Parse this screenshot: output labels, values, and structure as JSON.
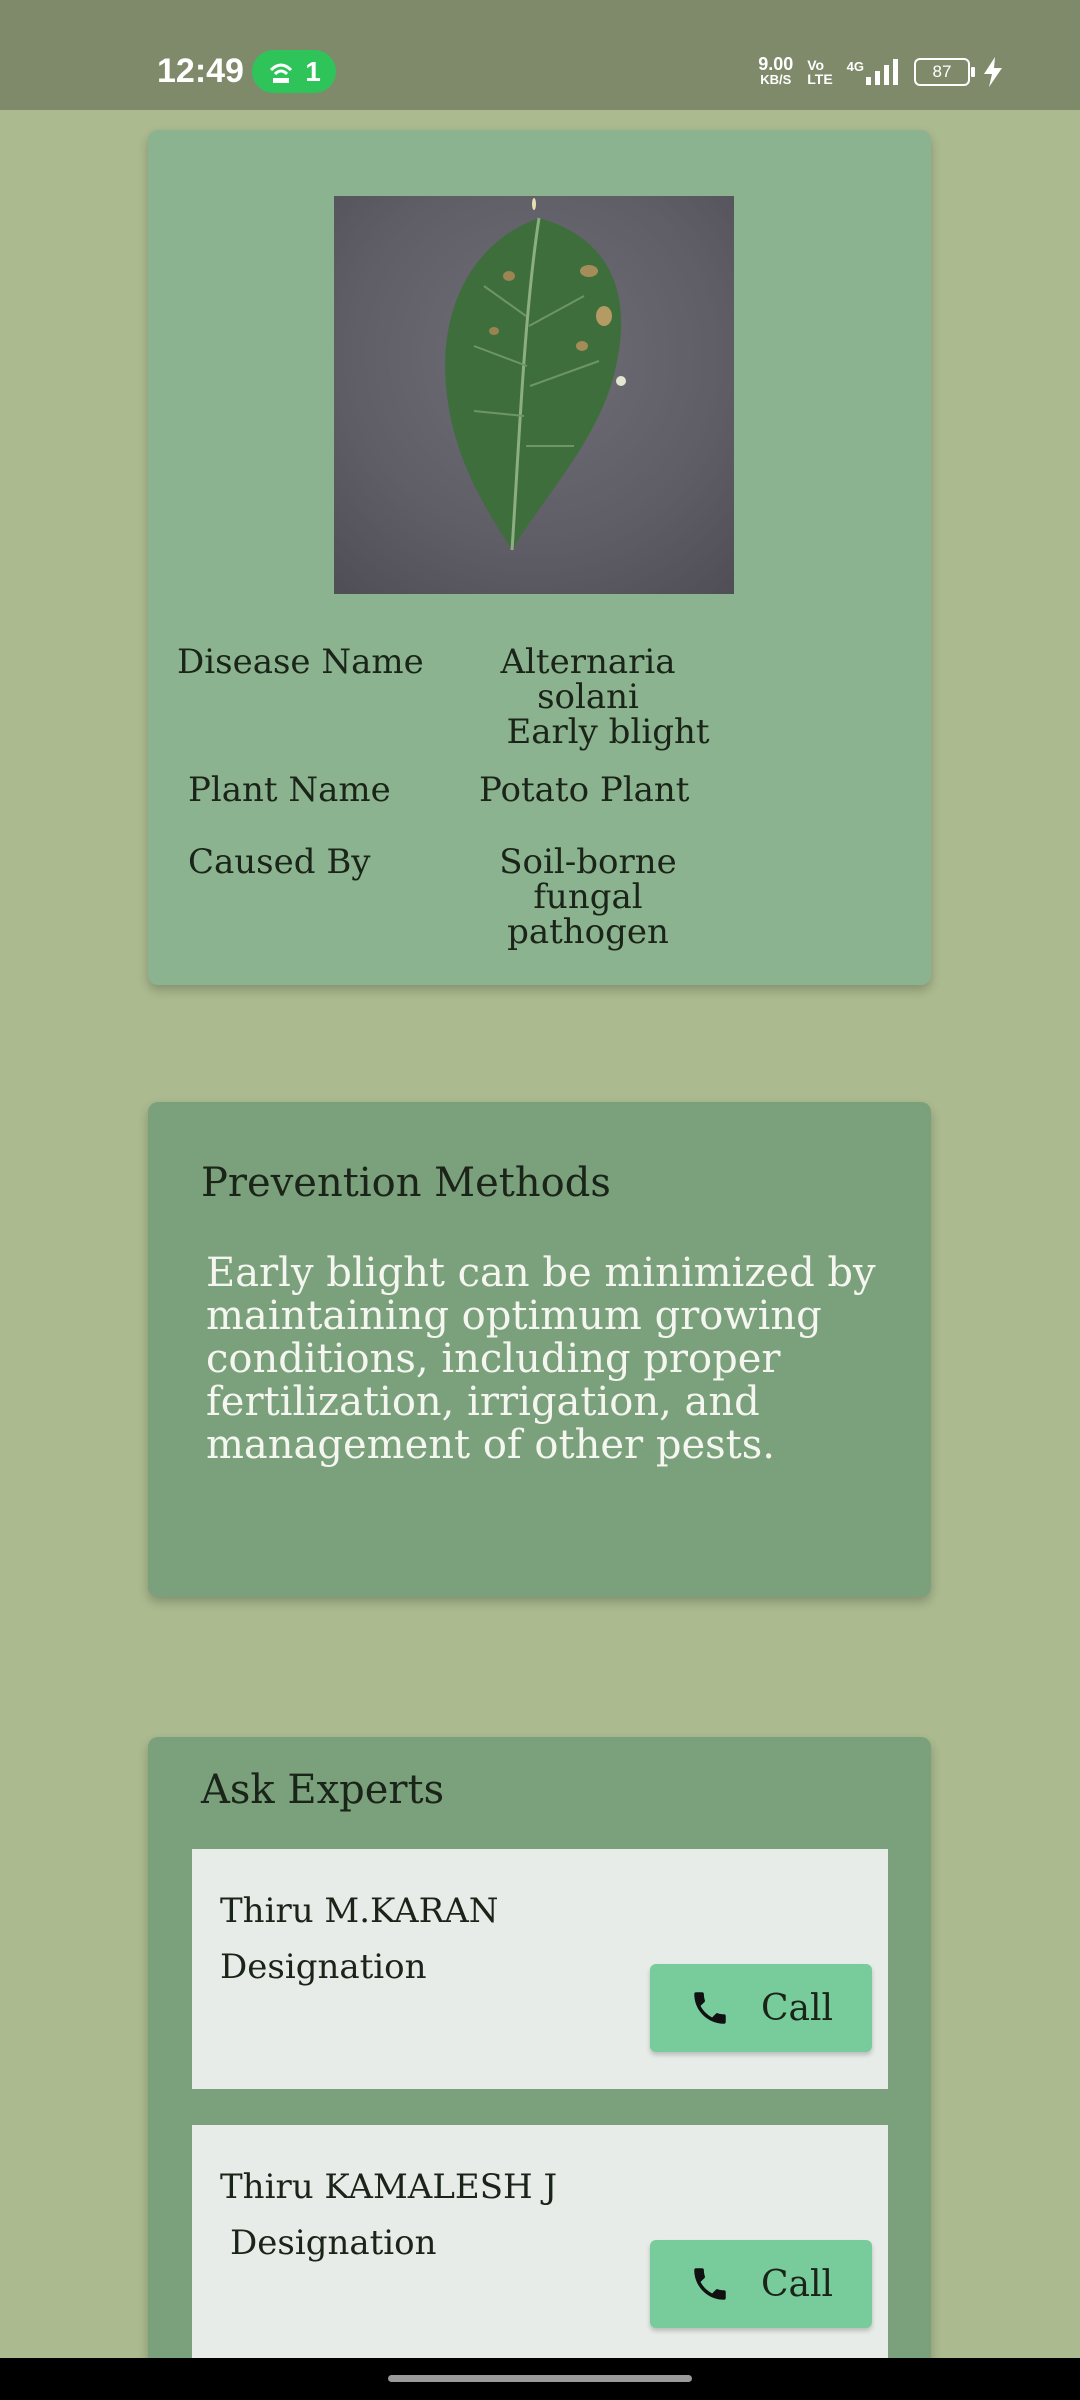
{
  "status_bar": {
    "time": "12:49",
    "hotspot_count": "1",
    "net_speed": "9.00",
    "net_speed_unit": "KB/S",
    "volte_top": "Vo",
    "volte_bottom": "LTE",
    "network": "4G",
    "battery": "87"
  },
  "details": {
    "disease_label": "Disease Name",
    "disease_line1": "Alternaria solani",
    "disease_line2": "Early blight",
    "plant_label": "Plant Name",
    "plant_value": "Potato Plant",
    "cause_label": "Caused By",
    "cause_line1": "Soil-borne fungal",
    "cause_line2": "pathogen"
  },
  "prevention": {
    "title": "Prevention Methods",
    "text": "Early blight can be minimized by maintaining optimum growing conditions, including proper fertilization, irrigation, and management of other pests."
  },
  "experts": {
    "title": "Ask Experts",
    "items": [
      {
        "name": "Thiru M.KARAN",
        "designation": "Designation",
        "call_label": "Call"
      },
      {
        "name": "Thiru KAMALESH J",
        "designation": "Designation",
        "call_label": "Call"
      }
    ]
  },
  "colors": {
    "background": "#abba8f",
    "details_card": "#8bb38f",
    "section_card": "#7aa17c",
    "call_button": "#78cc9c"
  }
}
